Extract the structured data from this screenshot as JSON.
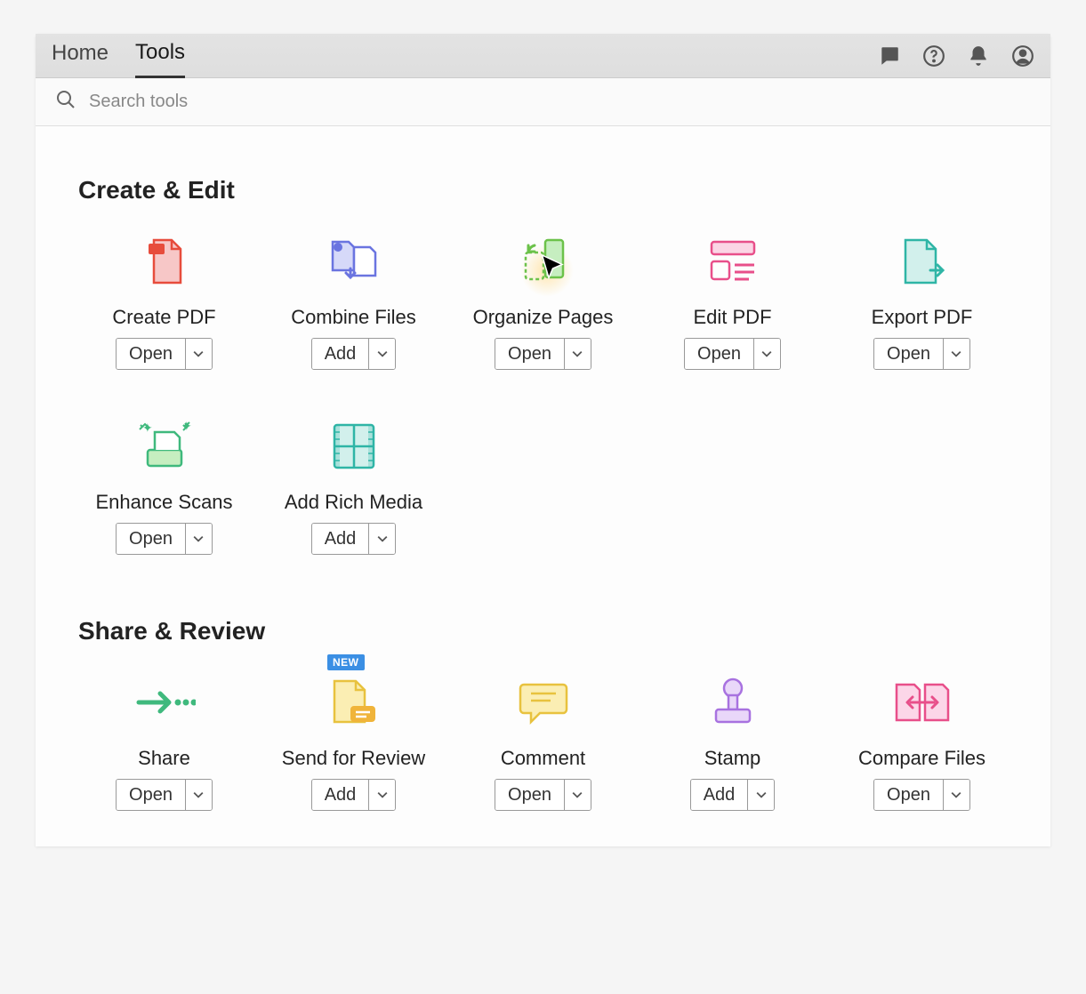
{
  "topbar": {
    "tabs": {
      "home": "Home",
      "tools": "Tools"
    },
    "active_tab": "tools"
  },
  "search": {
    "placeholder": "Search tools"
  },
  "sections": {
    "create_edit": {
      "title": "Create & Edit",
      "tools": [
        {
          "label": "Create PDF",
          "button": "Open"
        },
        {
          "label": "Combine Files",
          "button": "Add"
        },
        {
          "label": "Organize Pages",
          "button": "Open"
        },
        {
          "label": "Edit PDF",
          "button": "Open"
        },
        {
          "label": "Export PDF",
          "button": "Open"
        },
        {
          "label": "Enhance Scans",
          "button": "Open"
        },
        {
          "label": "Add Rich Media",
          "button": "Add"
        }
      ]
    },
    "share_review": {
      "title": "Share & Review",
      "tools": [
        {
          "label": "Share",
          "button": "Open"
        },
        {
          "label": "Send for Review",
          "button": "Add",
          "badge": "NEW"
        },
        {
          "label": "Comment",
          "button": "Open"
        },
        {
          "label": "Stamp",
          "button": "Add"
        },
        {
          "label": "Compare Files",
          "button": "Open"
        }
      ]
    }
  }
}
